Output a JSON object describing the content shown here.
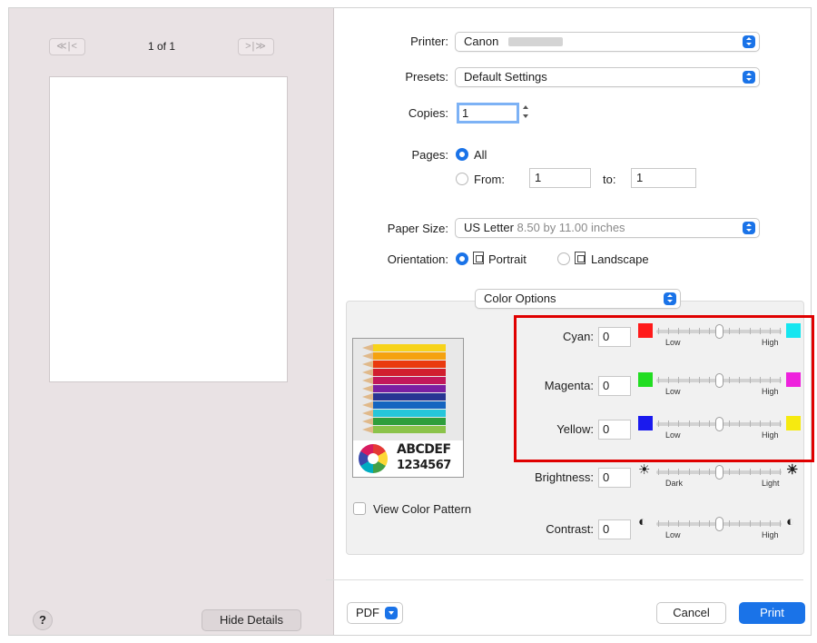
{
  "preview": {
    "first_prev_label": "≪|<",
    "next_last_label": ">|≫",
    "page_indicator": "1 of 1",
    "help_label": "?",
    "hide_details_label": "Hide Details"
  },
  "printer": {
    "label": "Printer:",
    "value": "Canon"
  },
  "presets": {
    "label": "Presets:",
    "value": "Default Settings"
  },
  "copies": {
    "label": "Copies:",
    "value": "1"
  },
  "pages": {
    "label": "Pages:",
    "all_label": "All",
    "from_label": "From:",
    "from_value": "1",
    "to_label": "to:",
    "to_value": "1",
    "selected": "all"
  },
  "paper_size": {
    "label": "Paper Size:",
    "value": "US Letter",
    "detail": "8.50 by 11.00 inches"
  },
  "orientation": {
    "label": "Orientation:",
    "portrait_label": "Portrait",
    "landscape_label": "Landscape",
    "selected": "portrait"
  },
  "section_popup": {
    "value": "Color Options"
  },
  "color_preview": {
    "line1": "ABCDEF",
    "line2": "1234567"
  },
  "view_color_pattern": {
    "label": "View Color Pattern",
    "checked": false
  },
  "sliders": [
    {
      "label": "Cyan:",
      "value": "0",
      "low": "Low",
      "high": "High",
      "left_color": "#ff1a1a",
      "right_color": "#16e6f0",
      "left_icon": "red-swatch-icon",
      "right_icon": "cyan-swatch-icon"
    },
    {
      "label": "Magenta:",
      "value": "0",
      "low": "Low",
      "high": "High",
      "left_color": "#22dd22",
      "right_color": "#ee22dd",
      "left_icon": "green-swatch-icon",
      "right_icon": "magenta-swatch-icon"
    },
    {
      "label": "Yellow:",
      "value": "0",
      "low": "Low",
      "high": "High",
      "left_color": "#1a1aee",
      "right_color": "#f6ea10",
      "left_icon": "blue-swatch-icon",
      "right_icon": "yellow-swatch-icon"
    },
    {
      "label": "Brightness:",
      "value": "0",
      "low": "Dark",
      "high": "Light",
      "left_symbol": "☀",
      "right_symbol": "☀",
      "left_icon": "sun-dim-icon",
      "right_icon": "sun-bright-icon"
    },
    {
      "label": "Contrast:",
      "value": "0",
      "low": "Low",
      "high": "High",
      "left_symbol": "◐",
      "right_symbol": "◐",
      "left_icon": "contrast-low-icon",
      "right_icon": "contrast-high-icon"
    }
  ],
  "footer": {
    "pdf_label": "PDF",
    "cancel_label": "Cancel",
    "print_label": "Print"
  },
  "colors": {
    "accent": "#1a73e8",
    "highlight_border": "#e00000",
    "sidebar_bg": "#e9e2e4"
  }
}
